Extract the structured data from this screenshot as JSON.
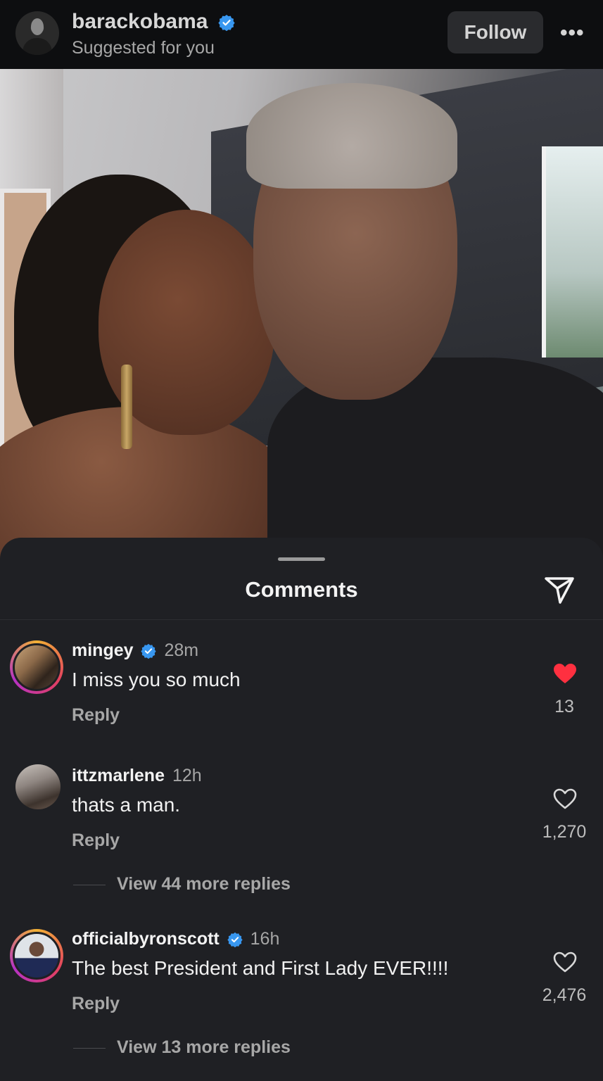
{
  "header": {
    "username": "barackobama",
    "subtitle": "Suggested for you",
    "follow_label": "Follow",
    "more_icon": "more-horizontal-icon"
  },
  "sheet": {
    "title": "Comments",
    "share_icon": "send-icon"
  },
  "colors": {
    "verified": "#3897f0",
    "liked": "#ff3040",
    "sheet_bg": "#1f2024"
  },
  "comments": [
    {
      "username": "mingey",
      "verified": true,
      "time": "28m",
      "text": "I miss you so much",
      "reply_label": "Reply",
      "liked": true,
      "like_count": "13"
    },
    {
      "username": "ittzmarlene",
      "verified": false,
      "time": "12h",
      "text": "thats a man.",
      "reply_label": "Reply",
      "liked": false,
      "like_count": "1,270",
      "view_replies": "View 44 more replies"
    },
    {
      "username": "officialbyronscott",
      "verified": true,
      "time": "16h",
      "text": "The best President and First Lady EVER!!!!",
      "reply_label": "Reply",
      "liked": false,
      "like_count": "2,476",
      "view_replies": "View 13 more replies"
    }
  ]
}
